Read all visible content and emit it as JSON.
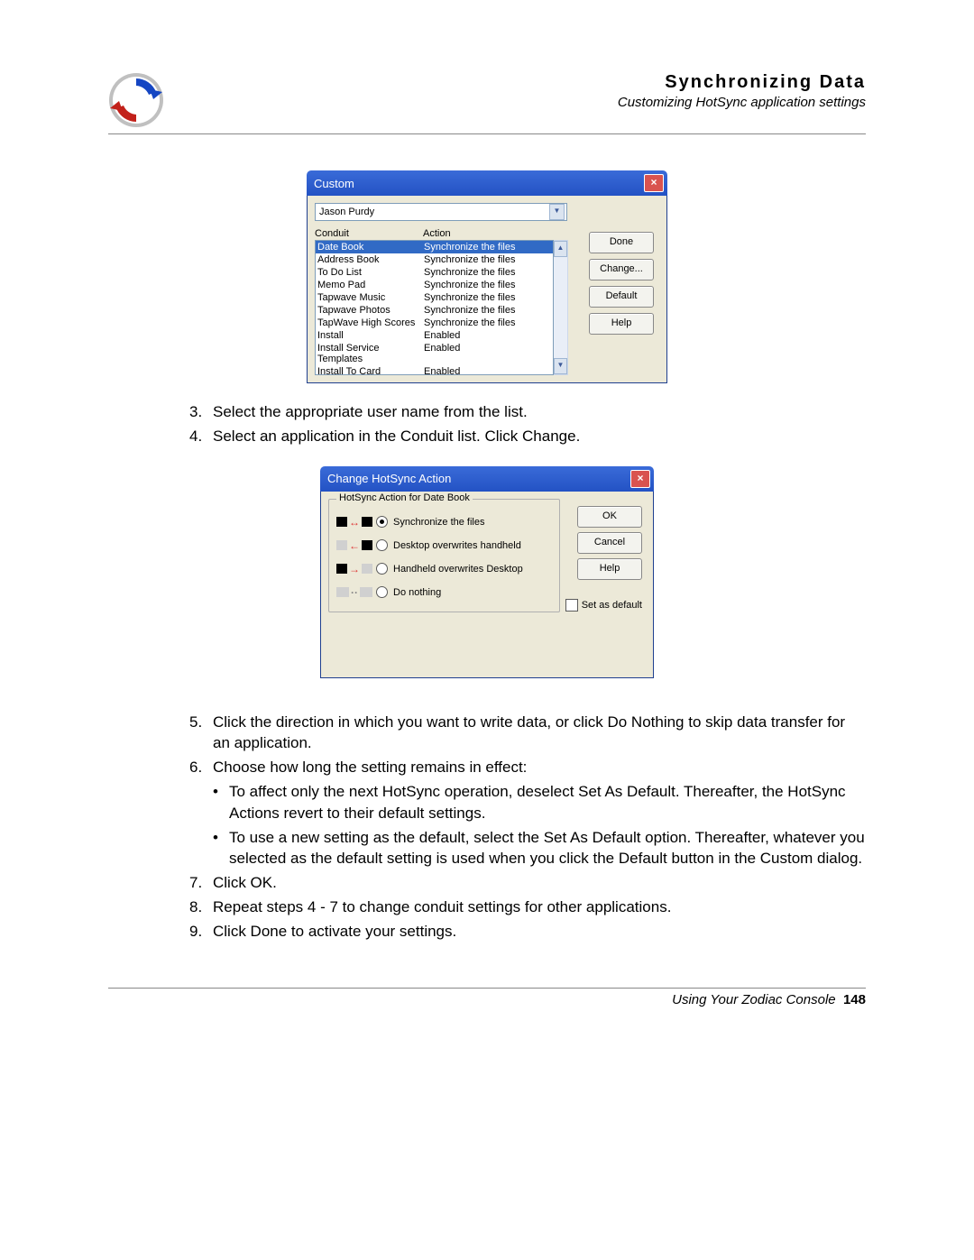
{
  "header": {
    "title": "Synchronizing Data",
    "subtitle": "Customizing HotSync application settings"
  },
  "customDialog": {
    "title": "Custom",
    "user": "Jason Purdy",
    "colConduit": "Conduit",
    "colAction": "Action",
    "rows": [
      {
        "conduit": "Date Book",
        "action": "Synchronize the files"
      },
      {
        "conduit": "Address Book",
        "action": "Synchronize the files"
      },
      {
        "conduit": "To Do List",
        "action": "Synchronize the files"
      },
      {
        "conduit": "Memo Pad",
        "action": "Synchronize the files"
      },
      {
        "conduit": "Tapwave Music",
        "action": "Synchronize the files"
      },
      {
        "conduit": "Tapwave Photos",
        "action": "Synchronize the files"
      },
      {
        "conduit": "TapWave High Scores",
        "action": "Synchronize the files"
      },
      {
        "conduit": "Install",
        "action": "Enabled"
      },
      {
        "conduit": "Install Service Templates",
        "action": "Enabled"
      },
      {
        "conduit": "Install To Card",
        "action": "Enabled"
      }
    ],
    "buttons": {
      "done": "Done",
      "change": "Change...",
      "default": "Default",
      "help": "Help"
    }
  },
  "changeDialog": {
    "title": "Change HotSync Action",
    "group": "HotSync Action for Date Book",
    "options": {
      "sync": "Synchronize the files",
      "desktop": "Desktop overwrites handheld",
      "handheld": "Handheld overwrites Desktop",
      "nothing": "Do nothing"
    },
    "buttons": {
      "ok": "OK",
      "cancel": "Cancel",
      "help": "Help"
    },
    "setDefault": "Set as default"
  },
  "instructions": {
    "s3": "Select the appropriate user name from the list.",
    "s4": "Select an application in the Conduit list. Click Change.",
    "s5": "Click the direction in which you want to write data, or click Do Nothing to skip data transfer for an application.",
    "s6": "Choose how long the setting remains in effect:",
    "b1": "To affect only the next HotSync operation, deselect Set As Default. Thereafter, the HotSync Actions revert to their default settings.",
    "b2": "To use a new setting as the default, select the Set As Default option. Thereafter, whatever you selected as the default setting is used when you click the Default button in the Custom dialog.",
    "s7": "Click OK.",
    "s8": "Repeat steps 4 - 7 to change conduit settings for other applications.",
    "s9": "Click Done to activate your settings."
  },
  "footer": {
    "text": "Using Your Zodiac Console",
    "page": "148"
  }
}
